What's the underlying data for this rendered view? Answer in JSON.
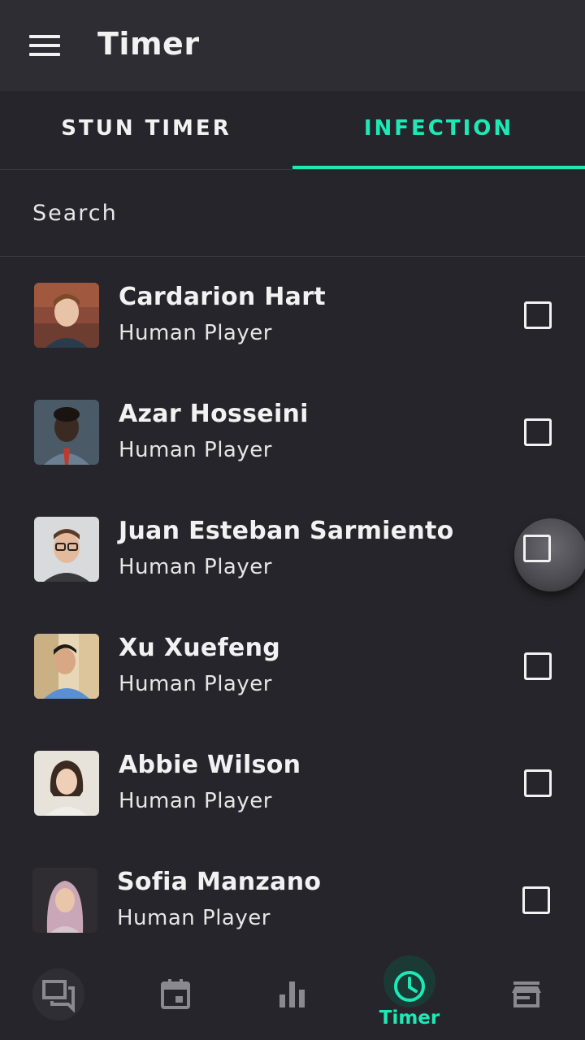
{
  "appbar": {
    "title": "Timer",
    "menu_icon": "menu-icon"
  },
  "tabs": [
    {
      "label": "STUN TIMER",
      "active": false
    },
    {
      "label": "INFECTION",
      "active": true
    }
  ],
  "search": {
    "placeholder": "Search"
  },
  "players": [
    {
      "name": "Cardarion Hart",
      "role": "Human Player",
      "checked": false
    },
    {
      "name": "Azar Hosseini",
      "role": "Human Player",
      "checked": false
    },
    {
      "name": "Juan Esteban Sarmiento",
      "role": "Human Player",
      "checked": false
    },
    {
      "name": "Xu Xuefeng",
      "role": "Human Player",
      "checked": false
    },
    {
      "name": "Abbie Wilson",
      "role": "Human Player",
      "checked": false
    },
    {
      "name": "Sofia Manzano",
      "role": "Human Player",
      "checked": false
    }
  ],
  "bottom_nav": [
    {
      "icon": "chat-icon",
      "label": ""
    },
    {
      "icon": "calendar-icon",
      "label": ""
    },
    {
      "icon": "bar-chart-icon",
      "label": ""
    },
    {
      "icon": "clock-icon",
      "label": "Timer",
      "active": true
    },
    {
      "icon": "store-icon",
      "label": ""
    }
  ],
  "colors": {
    "accent": "#1de9b6",
    "background": "#26252b",
    "appbar": "#2e2d33"
  }
}
